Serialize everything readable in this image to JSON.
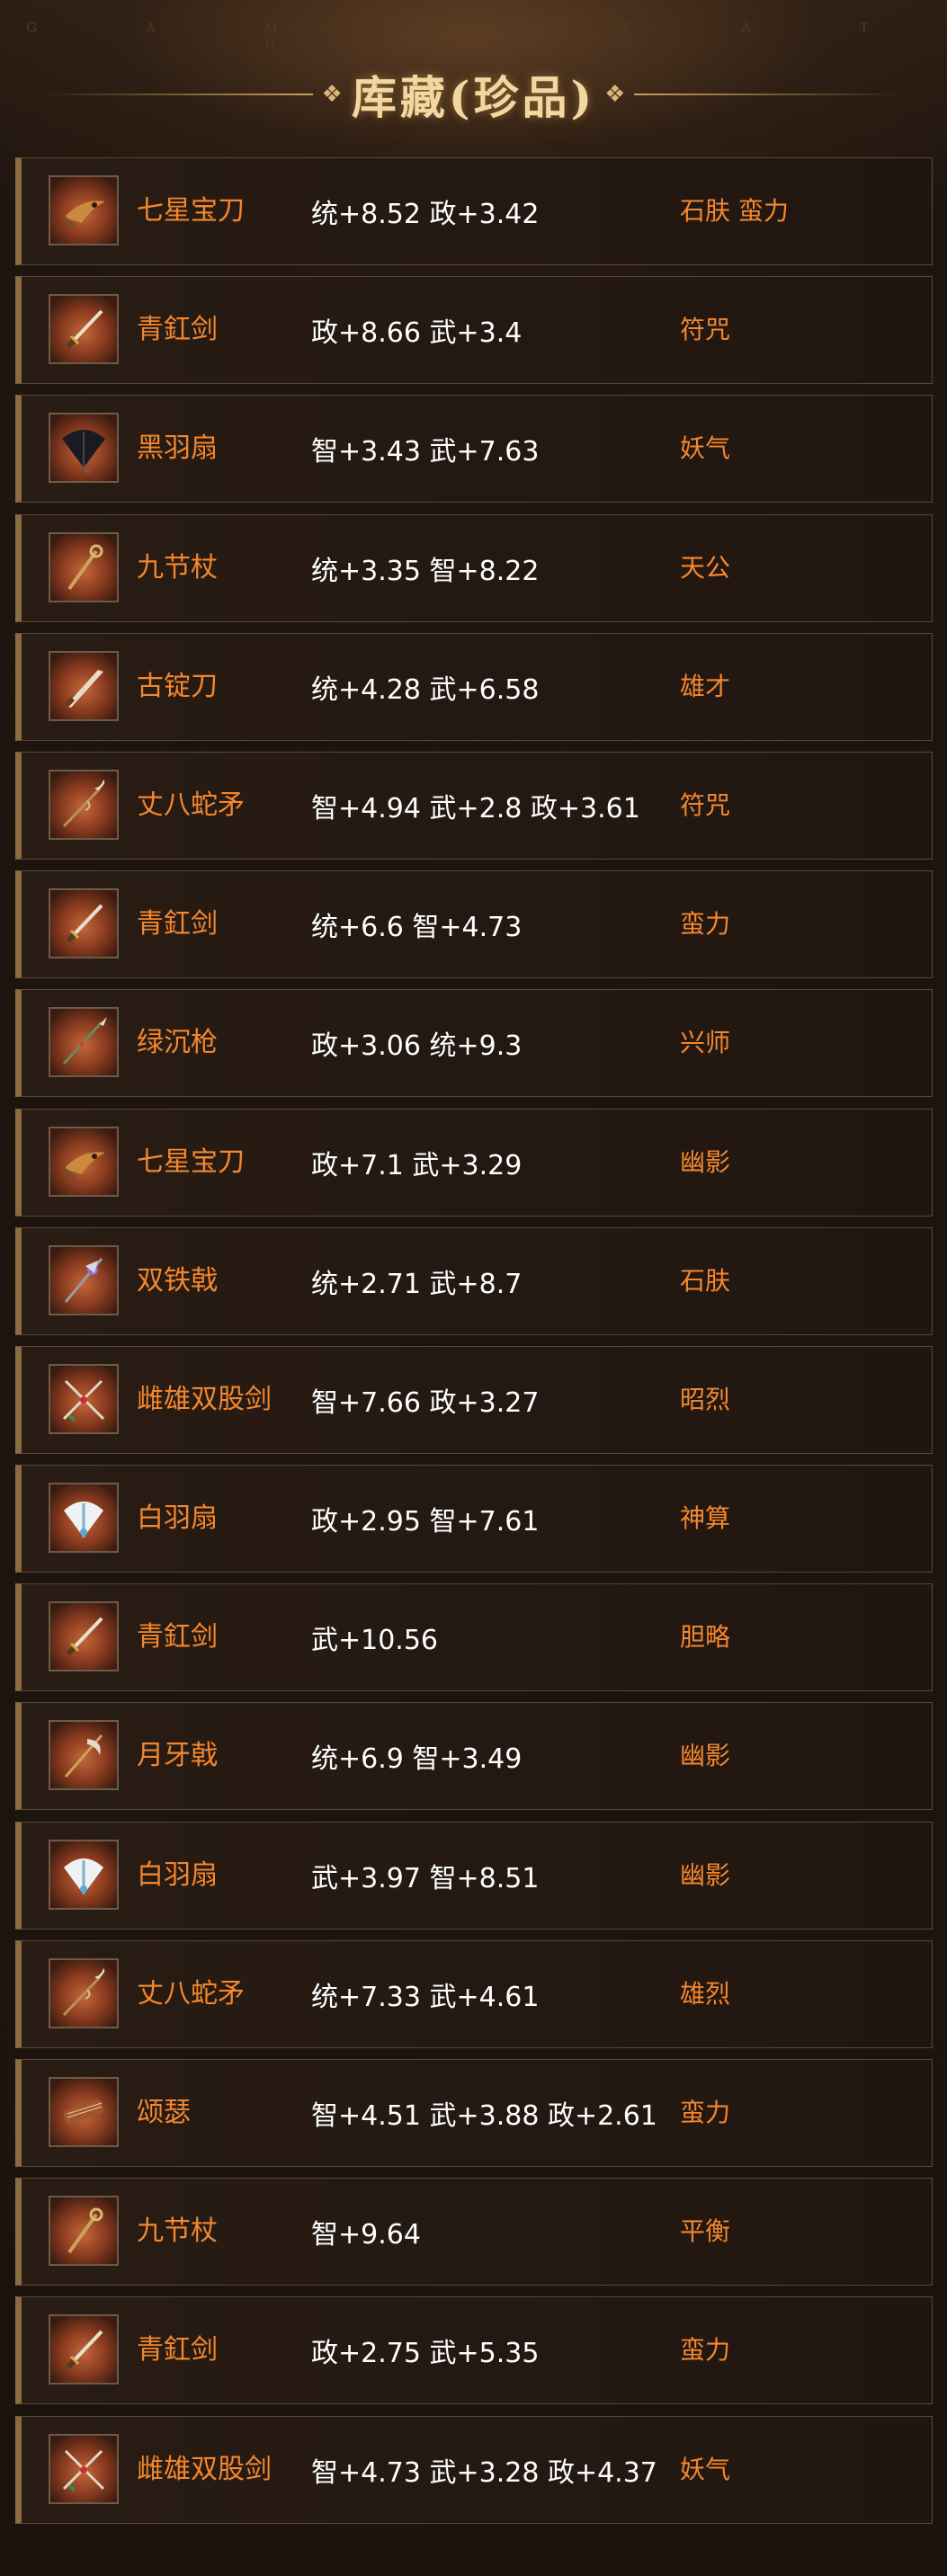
{
  "header": {
    "watermark": "G A M E   F E A T U R E S",
    "title": "库藏(珍品)"
  },
  "colors": {
    "name": "#f4872e",
    "stats": "#ffffff",
    "tags": "#f4872e",
    "border": "#5d4632",
    "accent": "#8a6a3f"
  },
  "items": [
    {
      "name": "七星宝刀",
      "stats": "统+8.52 政+3.42",
      "tags": "石肤 蛮力",
      "icon": "dragon-blade-icon"
    },
    {
      "name": "青釭剑",
      "stats": "政+8.66 武+3.4",
      "tags": "符咒",
      "icon": "sword-icon"
    },
    {
      "name": "黑羽扇",
      "stats": "智+3.43 武+7.63",
      "tags": "妖气",
      "icon": "black-fan-icon"
    },
    {
      "name": "九节杖",
      "stats": "统+3.35 智+8.22",
      "tags": "天公",
      "icon": "staff-icon"
    },
    {
      "name": "古锭刀",
      "stats": "统+4.28 武+6.58",
      "tags": "雄才",
      "icon": "blade-icon"
    },
    {
      "name": "丈八蛇矛",
      "stats": "智+4.94 武+2.8 政+3.61",
      "tags": "符咒",
      "icon": "serpent-spear-icon"
    },
    {
      "name": "青釭剑",
      "stats": "统+6.6 智+4.73",
      "tags": "蛮力",
      "icon": "sword-icon"
    },
    {
      "name": "绿沉枪",
      "stats": "政+3.06 统+9.3",
      "tags": "兴师",
      "icon": "spear-icon"
    },
    {
      "name": "七星宝刀",
      "stats": "政+7.1 武+3.29",
      "tags": "幽影",
      "icon": "dragon-blade-icon"
    },
    {
      "name": "双铁戟",
      "stats": "统+2.71 武+8.7",
      "tags": "石肤",
      "icon": "halberd-icon"
    },
    {
      "name": "雌雄双股剑",
      "stats": "智+7.66 政+3.27",
      "tags": "昭烈",
      "icon": "twin-swords-icon"
    },
    {
      "name": "白羽扇",
      "stats": "政+2.95 智+7.61",
      "tags": "神算",
      "icon": "white-fan-icon"
    },
    {
      "name": "青釭剑",
      "stats": "武+10.56",
      "tags": "胆略",
      "icon": "sword-icon"
    },
    {
      "name": "月牙戟",
      "stats": "统+6.9 智+3.49",
      "tags": "幽影",
      "icon": "crescent-halberd-icon"
    },
    {
      "name": "白羽扇",
      "stats": "武+3.97 智+8.51",
      "tags": "幽影",
      "icon": "white-fan-icon"
    },
    {
      "name": "丈八蛇矛",
      "stats": "统+7.33 武+4.61",
      "tags": "雄烈",
      "icon": "serpent-spear-icon"
    },
    {
      "name": "颂瑟",
      "stats": "智+4.51 武+3.88 政+2.61",
      "tags": "蛮力",
      "icon": "zither-icon"
    },
    {
      "name": "九节杖",
      "stats": "智+9.64",
      "tags": "平衡",
      "icon": "staff-icon"
    },
    {
      "name": "青釭剑",
      "stats": "政+2.75 武+5.35",
      "tags": "蛮力",
      "icon": "sword-icon"
    },
    {
      "name": "雌雄双股剑",
      "stats": "智+4.73 武+3.28 政+4.37",
      "tags": "妖气",
      "icon": "twin-swords-icon"
    }
  ]
}
